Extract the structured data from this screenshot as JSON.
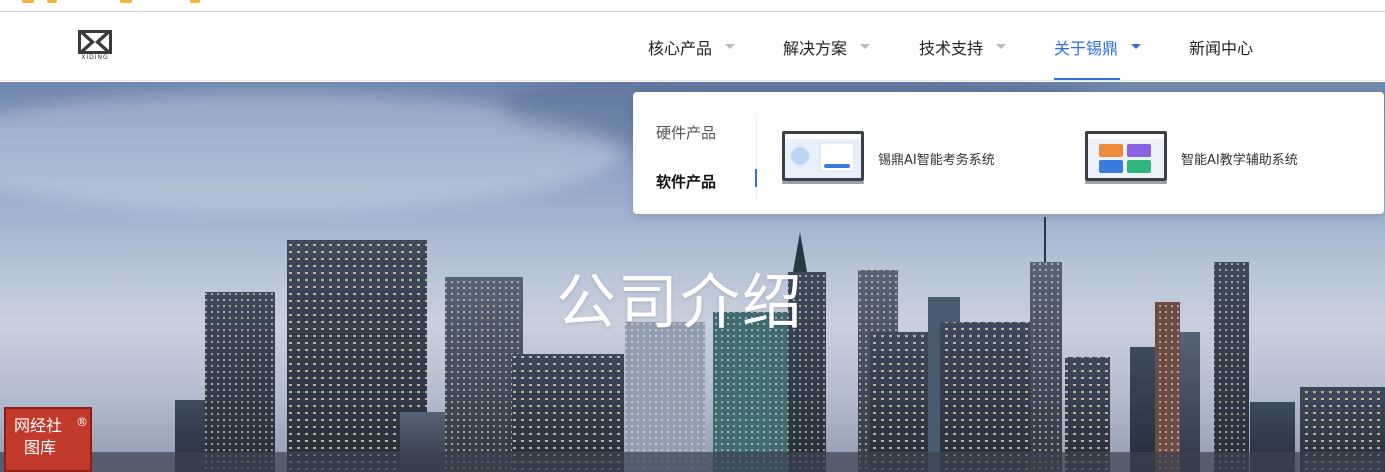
{
  "nav": {
    "items": [
      {
        "label": "核心产品",
        "has_caret": true,
        "active": false
      },
      {
        "label": "解决方案",
        "has_caret": true,
        "active": false
      },
      {
        "label": "技术支持",
        "has_caret": true,
        "active": false
      },
      {
        "label": "关于锡鼎",
        "has_caret": true,
        "active": true
      },
      {
        "label": "新闻中心",
        "has_caret": false,
        "active": false
      }
    ]
  },
  "logo": {
    "text": "XIDING",
    "icon": "xiding-logo-icon"
  },
  "hero": {
    "title": "公司介绍"
  },
  "dropdown": {
    "categories": [
      {
        "label": "硬件产品",
        "active": false
      },
      {
        "label": "软件产品",
        "active": true
      }
    ],
    "products": [
      {
        "label": "锡鼎AI智能考务系统",
        "icon": "exam-system-thumbnail"
      },
      {
        "label": "智能AI教学辅助系统",
        "icon": "teaching-system-thumbnail"
      }
    ]
  },
  "watermark": {
    "line1": "网经社",
    "line2": "图库",
    "mark": "®"
  },
  "colors": {
    "accent": "#2f6fe0",
    "watermark_bg": "#c0392b",
    "top_strip": "#f3b23a"
  }
}
